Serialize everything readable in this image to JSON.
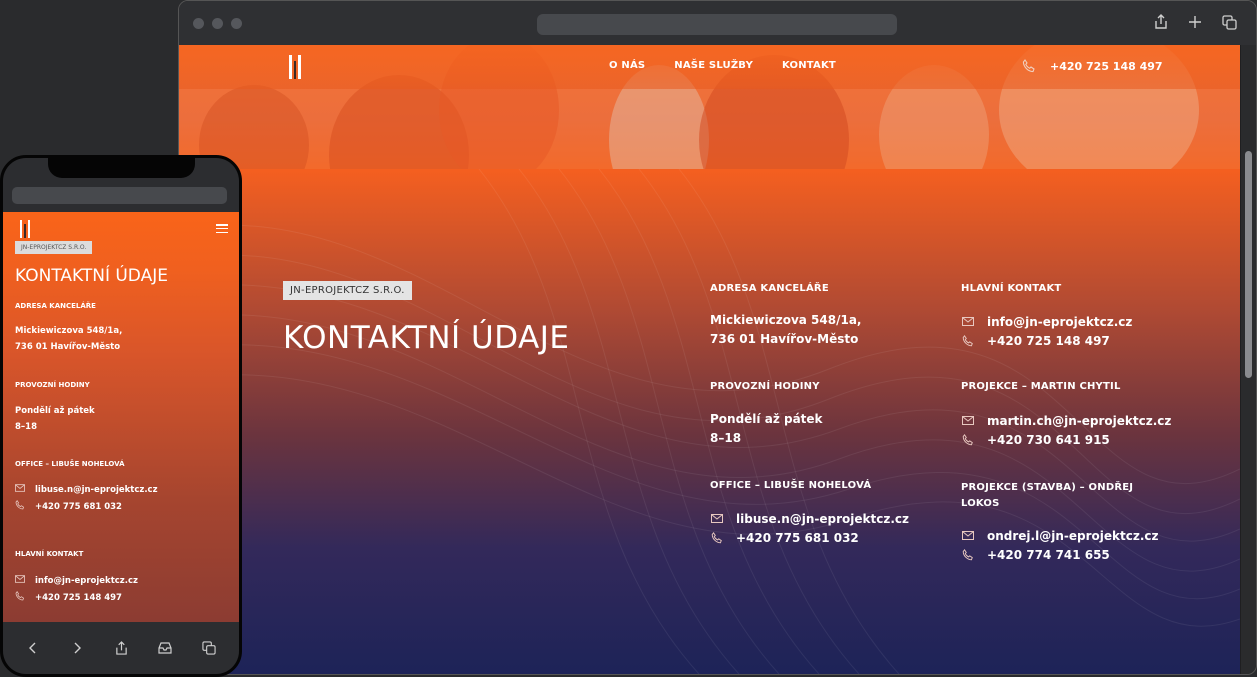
{
  "colors": {
    "accent_orange": "#fa5f17",
    "deep_navy": "#1d2358",
    "tag_bg": "#e4e4e4"
  },
  "nav": {
    "links": [
      "O NÁS",
      "NAŠE SLUŽBY",
      "KONTAKT"
    ],
    "phone": "+420 725 148 497",
    "phone_icon": "phone-icon"
  },
  "main": {
    "tag": "JN-EPROJEKTCZ S.R.O.",
    "title": "KONTAKTNÍ ÚDAJE",
    "address": {
      "label": "ADRESA KANCELÁŘE",
      "line1": "Mickiewiczova 548/1a,",
      "line2": "736 01 Havířov-Město"
    },
    "hours": {
      "label": "PROVOZNÍ HODINY",
      "line1": "Pondělí až pátek",
      "line2": "8–18"
    },
    "office": {
      "label": "OFFICE – LIBUŠE NOHELOVÁ",
      "email": "libuse.n@jn-eprojektcz.cz",
      "phone": "+420 775 681 032"
    },
    "main_contact": {
      "label": "HLAVNÍ KONTAKT",
      "email": "info@jn-eprojektcz.cz",
      "phone": "+420 725 148 497"
    },
    "projekce": {
      "label": "PROJEKCE – MARTIN CHYTIL",
      "email": "martin.ch@jn-eprojektcz.cz",
      "phone": "+420 730 641 915"
    },
    "projekce_stavba": {
      "label_line1": "PROJEKCE (STAVBA) – ONDŘEJ",
      "label_line2": "LOKOS",
      "email": "ondrej.l@jn-eprojektcz.cz",
      "phone": "+420 774 741 655"
    }
  },
  "mobile": {
    "title": "KONTAKTNÍ ÚDAJE",
    "tag": "JN-EPROJEKTCZ S.R.O.",
    "address_label": "ADRESA KANCELÁŘE",
    "address_line1": "Mickiewiczova 548/1a,",
    "address_line2": "736 01 Havířov-Město",
    "hours_label": "PROVOZNÍ HODINY",
    "hours_line1": "Pondělí až pátek",
    "hours_line2": "8–18",
    "office_label": "OFFICE – LIBUŠE NOHELOVÁ",
    "office_email": "libuse.n@jn-eprojektcz.cz",
    "office_phone": "+420 775 681 032",
    "main_label": "HLAVNÍ KONTAKT",
    "main_email": "info@jn-eprojektcz.cz",
    "main_phone": "+420 725 148 497"
  },
  "icons": {
    "browser_toolbar": [
      "share-icon",
      "new-tab-icon",
      "tabs-icon"
    ],
    "phone_toolbar": [
      "back-icon",
      "forward-icon",
      "share-icon",
      "bookmarks-icon",
      "tabs-icon"
    ],
    "phone_menu": "hamburger-menu-icon"
  }
}
